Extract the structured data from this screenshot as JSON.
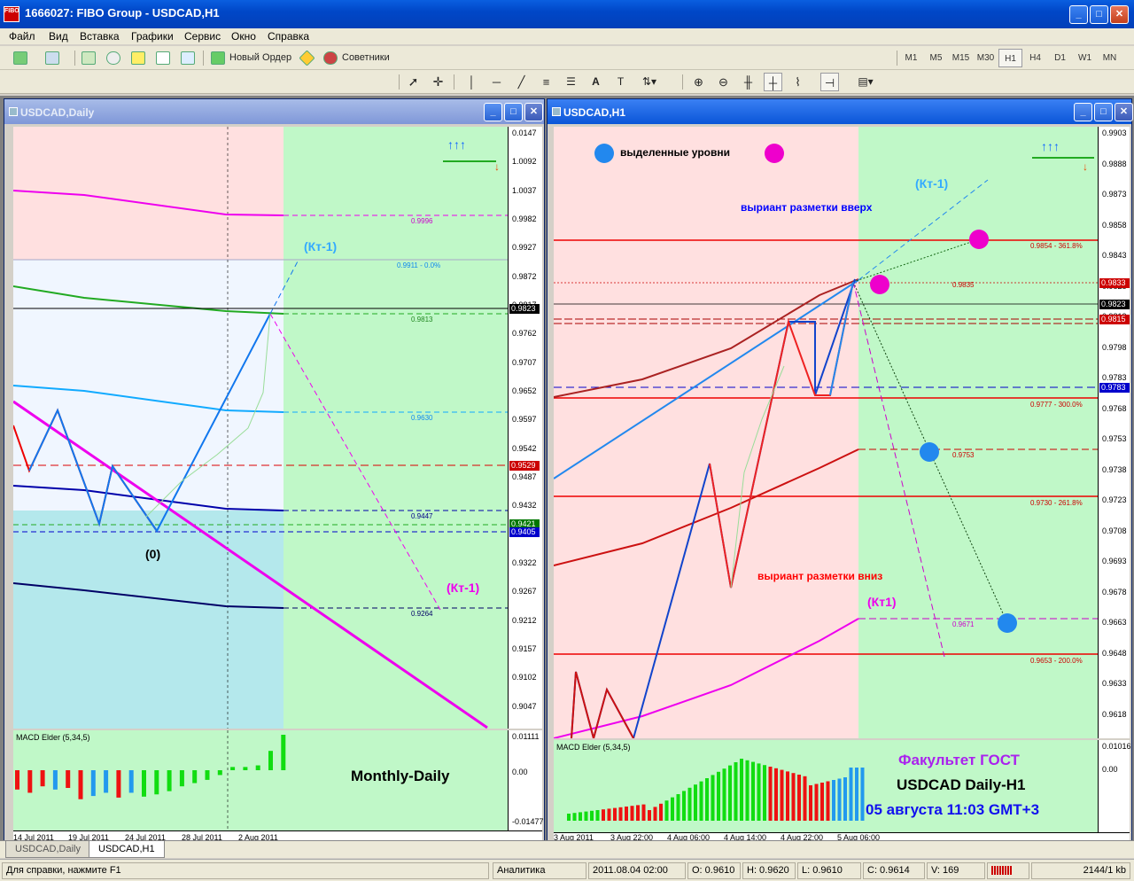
{
  "app": {
    "title": "1666027: FIBO Group - USDCAD,H1",
    "icon_text": "FIBO"
  },
  "window_buttons": {
    "min": "_",
    "max": "□",
    "close": "✕"
  },
  "menu": [
    "Файл",
    "Вид",
    "Вставка",
    "Графики",
    "Сервис",
    "Окно",
    "Справка"
  ],
  "toolbar": {
    "new_order": "Новый Ордер",
    "experts": "Советники",
    "timeframes": [
      "M1",
      "M5",
      "M15",
      "M30",
      "H1",
      "H4",
      "D1",
      "W1",
      "MN"
    ],
    "active_tf": "H1"
  },
  "left_chart": {
    "title": "USDCAD,Daily",
    "price_labels": [
      "0.0147",
      "1.0092",
      "1.0037",
      "0.9982",
      "0.9927",
      "0.9872",
      "0.9817",
      "0.9762",
      "0.9707",
      "0.9652",
      "0.9597",
      "0.9542",
      "0.9487",
      "0.9432",
      "0.9377",
      "0.9322",
      "0.9267",
      "0.9212",
      "0.9157",
      "0.9102",
      "0.9047"
    ],
    "price_tags": [
      {
        "text": "0.9823",
        "color": "#000000"
      },
      {
        "text": "0.9529",
        "color": "#cc0000"
      },
      {
        "text": "0.9421",
        "color": "#007700"
      },
      {
        "text": "0.9405",
        "color": "#0000cc"
      }
    ],
    "level_labels": [
      "0.9996",
      "0.9911 - 0.0%",
      "0.9813",
      "0.9630",
      "0.9447",
      "0.9264"
    ],
    "annotations": {
      "kt_up": "(Кт-1)",
      "kt_down": "(Кт-1)",
      "zero": "(0)",
      "monthly_daily": "Monthly-Daily"
    },
    "macd_title": "MACD Elder (5,34,5)",
    "macd_axis": [
      "0.01111",
      "0.00",
      "-0.01477"
    ],
    "macd_bars": [
      {
        "v": -0.006,
        "c": "red"
      },
      {
        "v": -0.007,
        "c": "red"
      },
      {
        "v": -0.005,
        "c": "red"
      },
      {
        "v": -0.006,
        "c": "dodger"
      },
      {
        "v": -0.0055,
        "c": "red"
      },
      {
        "v": -0.009,
        "c": "red"
      },
      {
        "v": -0.008,
        "c": "dodger"
      },
      {
        "v": -0.007,
        "c": "dodger"
      },
      {
        "v": -0.0085,
        "c": "red"
      },
      {
        "v": -0.007,
        "c": "dodger"
      },
      {
        "v": -0.0082,
        "c": "green"
      },
      {
        "v": -0.0075,
        "c": "green"
      },
      {
        "v": -0.0065,
        "c": "green"
      },
      {
        "v": -0.005,
        "c": "green"
      },
      {
        "v": -0.004,
        "c": "green"
      },
      {
        "v": -0.003,
        "c": "green"
      },
      {
        "v": -0.0015,
        "c": "green"
      },
      {
        "v": 0.001,
        "c": "green"
      },
      {
        "v": 0.001,
        "c": "green"
      },
      {
        "v": 0.0015,
        "c": "green"
      },
      {
        "v": 0.006,
        "c": "green"
      },
      {
        "v": 0.011,
        "c": "green"
      }
    ],
    "time_labels": [
      "14 Jul 2011",
      "19 Jul 2011",
      "24 Jul 2011",
      "28 Jul 2011",
      "2 Aug 2011"
    ]
  },
  "right_chart": {
    "title": "USDCAD,H1",
    "price_labels": [
      "0.9903",
      "0.9888",
      "0.9873",
      "0.9858",
      "0.9843",
      "0.9828",
      "0.9813",
      "0.9798",
      "0.9783",
      "0.9768",
      "0.9753",
      "0.9738",
      "0.9723",
      "0.9708",
      "0.9693",
      "0.9678",
      "0.9663",
      "0.9648",
      "0.9633",
      "0.9618"
    ],
    "price_tags": [
      {
        "text": "0.9833",
        "color": "#cc0000"
      },
      {
        "text": "0.9823",
        "color": "#000000"
      },
      {
        "text": "0.9815",
        "color": "#cc0000"
      },
      {
        "text": "0.9783",
        "color": "#0000cc"
      }
    ],
    "level_labels": [
      "0.9854 - 361.8%",
      "0.9835",
      "0.9777 - 300.0%",
      "0.9753",
      "0.9730 - 261.8%",
      "0.9671",
      "0.9653 - 200.0%"
    ],
    "annotations": {
      "highlighted": "выделенные уровни",
      "kt_up": "(Кт-1)",
      "variant_up": "выриант разметки вверх",
      "variant_down": "выриант разметки вниз",
      "kt1": "(Кт1)",
      "faculty": "Факультет ГОСТ",
      "pair": "USDCAD Daily-H1",
      "date": "05 августа 11:03 GMT+3"
    },
    "macd_title": "MACD Elder (5,34,5)",
    "macd_axis": [
      "0.01016",
      "0.00"
    ],
    "time_labels": [
      "3 Aug 2011",
      "3 Aug 22:00",
      "4 Aug 06:00",
      "4 Aug 14:00",
      "4 Aug 22:00",
      "5 Aug 06:00"
    ]
  },
  "tabs": [
    "USDCAD,Daily",
    "USDCAD,H1"
  ],
  "active_tab": "USDCAD,H1",
  "status": {
    "help": "Для справки, нажмите F1",
    "profile": "Аналитика",
    "datetime": "2011.08.04 02:00",
    "open": "O: 0.9610",
    "high": "H: 0.9620",
    "low": "L: 0.9610",
    "close": "C: 0.9614",
    "volume": "V: 169",
    "traffic": "2144/1 kb"
  }
}
